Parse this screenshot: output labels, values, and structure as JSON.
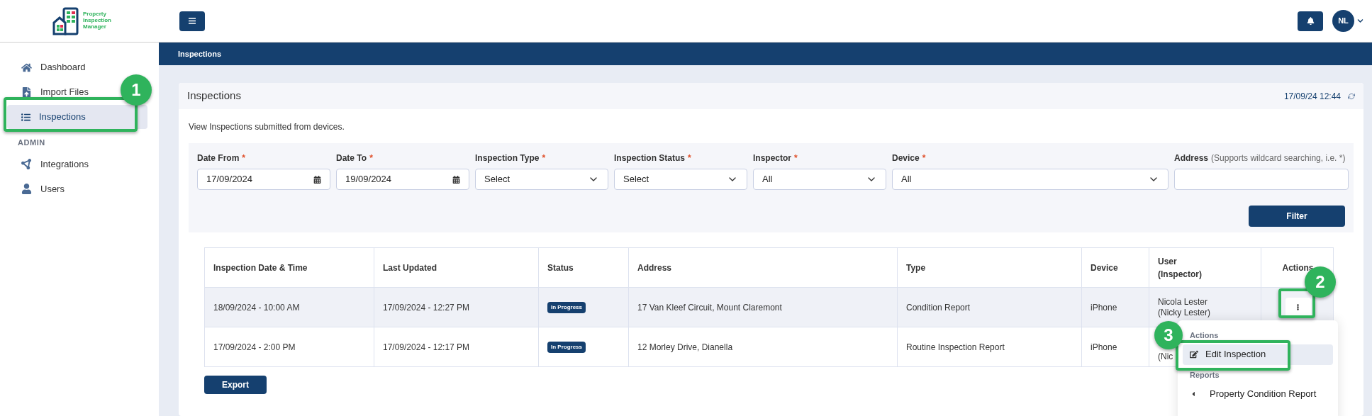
{
  "header": {
    "logo_text": "Property Inspection Manager",
    "avatar": "NL"
  },
  "sidebar": {
    "items": [
      {
        "label": "Dashboard",
        "kind": "home",
        "selected": false
      },
      {
        "label": "Import Files",
        "kind": "file",
        "selected": false
      },
      {
        "label": "Inspections",
        "kind": "list",
        "selected": true
      }
    ],
    "section": "ADMIN",
    "admin_items": [
      {
        "label": "Integrations",
        "kind": "network",
        "selected": false
      },
      {
        "label": "Users",
        "kind": "user",
        "selected": false
      }
    ]
  },
  "page_bar": {
    "title": "Inspections"
  },
  "card": {
    "title": "Inspections",
    "timestamp": "17/09/24 12:44",
    "description": "View Inspections submitted from devices."
  },
  "filters": [
    {
      "label": "Date From",
      "required_mark": "*",
      "kind": "date",
      "value": "17/09/2024"
    },
    {
      "label": "Date To",
      "required_mark": "*",
      "kind": "date",
      "value": "19/09/2024"
    },
    {
      "label": "Inspection Type",
      "required_mark": "*",
      "kind": "select",
      "value": "Select"
    },
    {
      "label": "Inspection Status",
      "required_mark": "*",
      "kind": "select",
      "value": "Select"
    },
    {
      "label": "Inspector",
      "required_mark": "*",
      "kind": "select",
      "value": "All"
    },
    {
      "label": "Device",
      "required_mark": "*",
      "kind": "select",
      "value": "All"
    },
    {
      "label": "Address",
      "hint": "(Supports wildcard searching, i.e. *)",
      "kind": "text"
    }
  ],
  "filter_button": "Filter",
  "table": {
    "columns": [
      "Inspection Date & Time",
      "Last Updated",
      "Status",
      "Address",
      "Type",
      "Device",
      "User (Inspector)",
      "Actions"
    ],
    "rows": [
      {
        "selected": true,
        "inspection_date": "18/09/2024 - 10:00 AM",
        "last_updated": "17/09/2024 - 12:27 PM",
        "status": "In Progress",
        "address": "17 Van Kleef Circuit, Mount Claremont",
        "type": "Condition Report",
        "device": "iPhone",
        "user": "Nicola Lester (Nicky Lester)",
        "has_actions": true
      },
      {
        "selected": false,
        "inspection_date": "17/09/2024 - 2:00 PM",
        "last_updated": "17/09/2024 - 12:17 PM",
        "status": "In Progress",
        "address": "12 Morley Drive, Dianella",
        "type": "Routine Inspection Report",
        "device": "iPhone",
        "user": "(Nic",
        "has_actions": false
      }
    ]
  },
  "export_button": "Export",
  "actions_menu": {
    "sections": [
      {
        "heading": "Actions",
        "items": [
          {
            "label": "Edit Inspection",
            "kind": "edit",
            "selected": true
          }
        ]
      },
      {
        "heading": "Reports",
        "items": [
          {
            "label": "Property Condition Report",
            "kind": "caret",
            "selected": false
          }
        ]
      }
    ]
  },
  "callouts": [
    {
      "label": "1"
    },
    {
      "label": "2"
    },
    {
      "label": "3"
    }
  ]
}
